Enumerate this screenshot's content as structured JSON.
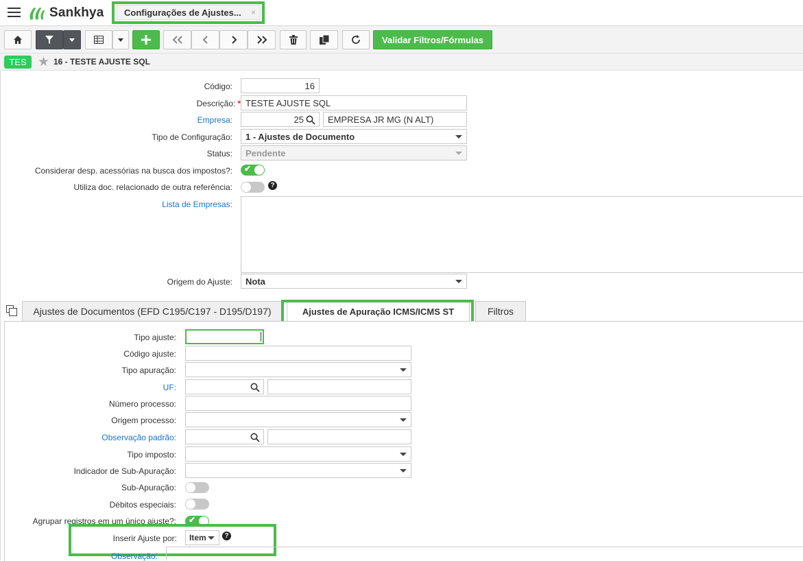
{
  "app": {
    "brand": "Sankhya"
  },
  "window_tab": {
    "label": "Configurações de Ajustes...",
    "close": "×"
  },
  "toolbar": {
    "validate_label": "Validar Filtros/Fórmulas"
  },
  "record": {
    "badge": "TES",
    "title": "16 - TESTE AJUSTE SQL"
  },
  "form": {
    "codigo": {
      "label": "Código:",
      "value": "16"
    },
    "descricao": {
      "label": "Descrição:",
      "required_mark": "*",
      "value": "TESTE AJUSTE SQL"
    },
    "empresa": {
      "label": "Empresa:",
      "code": "25",
      "name": "EMPRESA JR MG (N ALT)"
    },
    "tipo_configuracao": {
      "label": "Tipo de Configuração:",
      "value": "1 - Ajustes de Documento"
    },
    "status": {
      "label": "Status:",
      "value": "Pendente"
    },
    "considerar": {
      "label": "Considerar desp. acessórias na busca dos impostos?:",
      "on": true,
      "check": "✔"
    },
    "utiliza_doc": {
      "label": "Utiliza doc. relacionado de outra referência:",
      "on": false,
      "help": "?"
    },
    "lista_empresas": {
      "label": "Lista de Empresas:"
    },
    "origem_ajuste": {
      "label": "Origem do Ajuste:",
      "value": "Nota"
    }
  },
  "tabs": [
    {
      "label": "Ajustes de Documentos (EFD C195/C197 - D195/D197)",
      "active": false
    },
    {
      "label": "Ajustes de Apuração ICMS/ICMS ST",
      "active": true
    },
    {
      "label": "Filtros",
      "active": false
    }
  ],
  "panel": {
    "tipo_ajuste": {
      "label": "Tipo ajuste:",
      "value": ""
    },
    "codigo_ajuste": {
      "label": "Código ajuste:",
      "value": ""
    },
    "tipo_apuracao": {
      "label": "Tipo apuração:",
      "value": ""
    },
    "uf": {
      "label": "UF:",
      "code": "",
      "name": ""
    },
    "numero_processo": {
      "label": "Número processo:",
      "value": ""
    },
    "origem_processo": {
      "label": "Origem processo:",
      "value": ""
    },
    "observacao_padrao": {
      "label": "Observação padrão:",
      "code": "",
      "name": ""
    },
    "tipo_imposto": {
      "label": "Tipo imposto:",
      "value": ""
    },
    "indicador_sub": {
      "label": "Indicador de Sub-Apuração:",
      "value": ""
    },
    "sub_apuracao": {
      "label": "Sub-Apuração:",
      "on": false
    },
    "debitos_especiais": {
      "label": "Débitos especiais:",
      "on": false
    },
    "agrupar": {
      "label": "Agrupar registros em um único ajuste?:",
      "on": true,
      "check": "✔"
    },
    "inserir_ajuste": {
      "label": "Inserir Ajuste por:",
      "value": "Item",
      "help": "?"
    },
    "observacao": {
      "label": "Observação:"
    }
  }
}
